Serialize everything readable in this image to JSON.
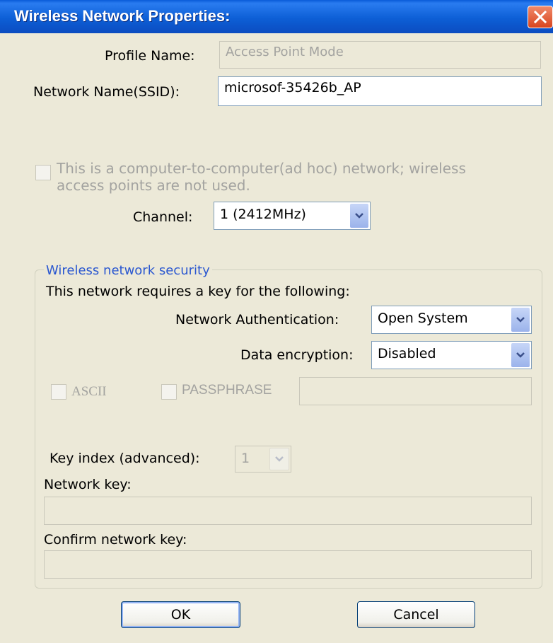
{
  "window": {
    "title": "Wireless Network Properties:"
  },
  "profile": {
    "label": "Profile Name:",
    "value": "Access Point Mode"
  },
  "ssid": {
    "label": "Network Name(SSID):",
    "value": "microsof-35426b_AP"
  },
  "adhoc": {
    "label_line1": "This is a computer-to-computer(ad hoc) network; wireless",
    "label_line2": "access points are not used.",
    "checked": false
  },
  "channel": {
    "label": "Channel:",
    "value": "1  (2412MHz)"
  },
  "security": {
    "legend": "Wireless network security",
    "intro": "This network requires a key for the following:",
    "auth_label": "Network Authentication:",
    "auth_value": "Open System",
    "encryption_label": "Data encryption:",
    "encryption_value": "Disabled",
    "ascii_label": "ASCII",
    "passphrase_label": "PASSPHRASE",
    "key_index_label": "Key index (advanced):",
    "key_index_value": "1",
    "network_key_label": "Network key:",
    "confirm_key_label": "Confirm network key:"
  },
  "buttons": {
    "ok": "OK",
    "cancel": "Cancel"
  }
}
